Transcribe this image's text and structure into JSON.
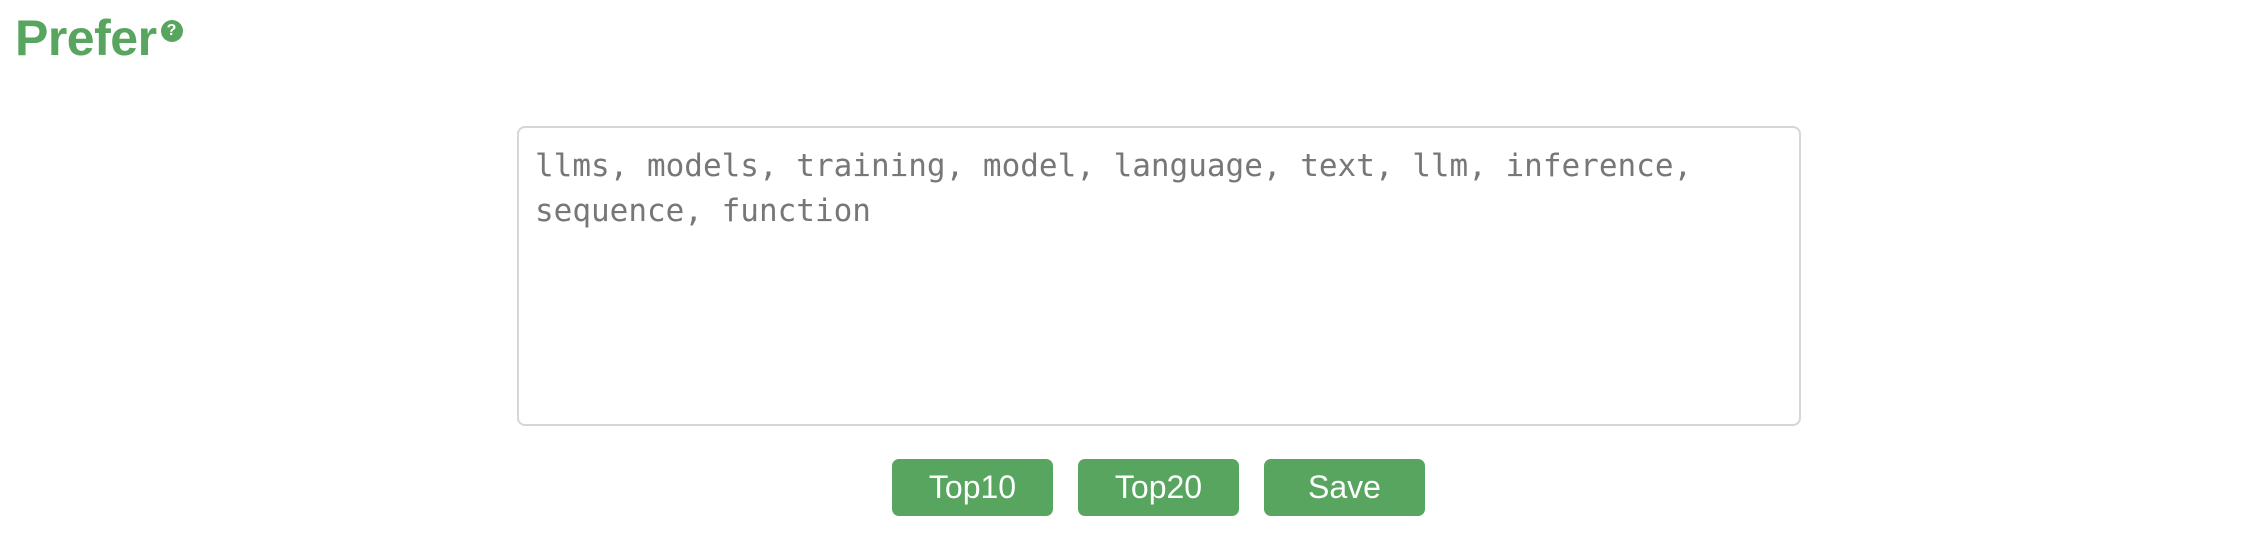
{
  "header": {
    "title": "Prefer",
    "help_glyph": "?"
  },
  "editor": {
    "value": "llms, models, training, model, language, text, llm, inference, sequence, function"
  },
  "actions": {
    "top10_label": "Top10",
    "top20_label": "Top20",
    "save_label": "Save"
  },
  "colors": {
    "accent": "#57a55f",
    "border": "#d6d6d6",
    "text_muted": "#777777"
  },
  "icons": {
    "help": "question-circle-icon"
  }
}
